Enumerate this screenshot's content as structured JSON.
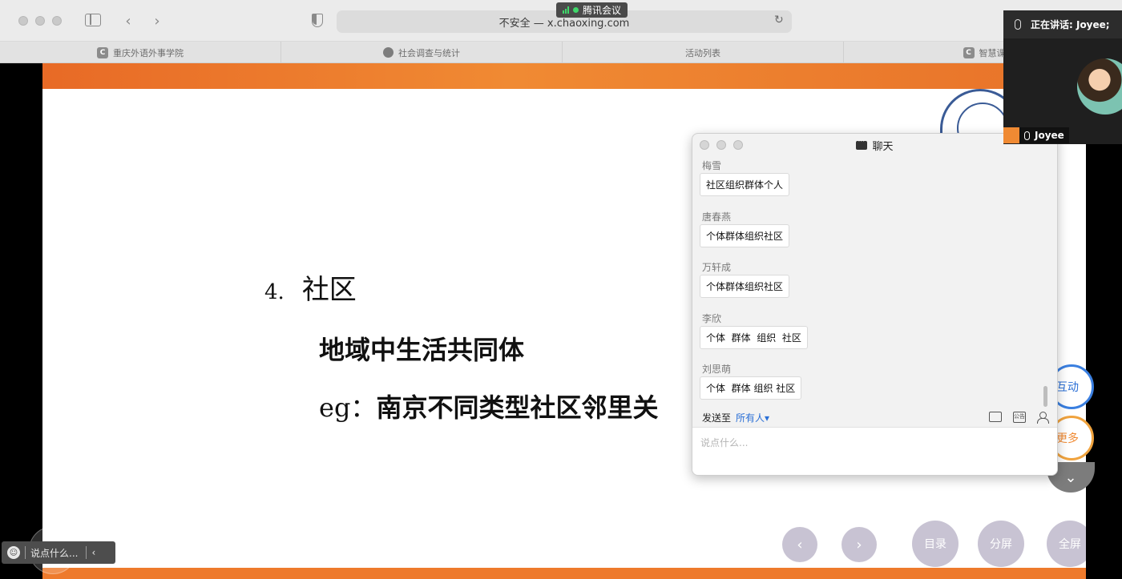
{
  "browser": {
    "url_label": "不安全 — x.chaoxing.com",
    "back_glyph": "‹",
    "forward_glyph": "›",
    "reload_glyph": "↻",
    "meeting_badge": "腾讯会议",
    "tabs": [
      {
        "label": "重庆外语外事学院",
        "favicon": "C"
      },
      {
        "label": "社会调查与统计",
        "favicon": "globe"
      },
      {
        "label": "活动列表",
        "favicon": ""
      },
      {
        "label": "智慧课",
        "favicon": "C"
      }
    ]
  },
  "slide": {
    "number": "4.",
    "heading": "社区",
    "line1": "地域中生活共同体",
    "line2_prefix": "eg：",
    "line2_text": "南京不同类型社区邻里关"
  },
  "controls": {
    "prev": "‹",
    "next": "›",
    "catalog": "目录",
    "split": "分屏",
    "fullscreen": "全屏",
    "interact": "互动",
    "more": "更多",
    "collapse": "⌄",
    "say_placeholder": "说点什么...",
    "say_collapse": "‹"
  },
  "chat": {
    "title": "聊天",
    "messages": [
      {
        "sender": "梅雪",
        "text": "社区组织群体个人"
      },
      {
        "sender": "唐春燕",
        "text": "个体群体组织社区"
      },
      {
        "sender": "万轩成",
        "text": "个体群体组织社区"
      },
      {
        "sender": "李欣",
        "text": "个体  群体  组织  社区"
      },
      {
        "sender": "刘思萌",
        "text": "个体  群体 组织 社区"
      }
    ],
    "send_to_label": "发送至",
    "send_to_value": "所有人▾",
    "input_placeholder": "说点什么...",
    "notice_label": "公告"
  },
  "video": {
    "speaking_label": "正在讲话: Joyee;",
    "participant_name": "Joyee"
  },
  "colors": {
    "accent_orange": "#F08A33",
    "accent_blue": "#2A6FD6",
    "meeting_green": "#3FD76A"
  }
}
